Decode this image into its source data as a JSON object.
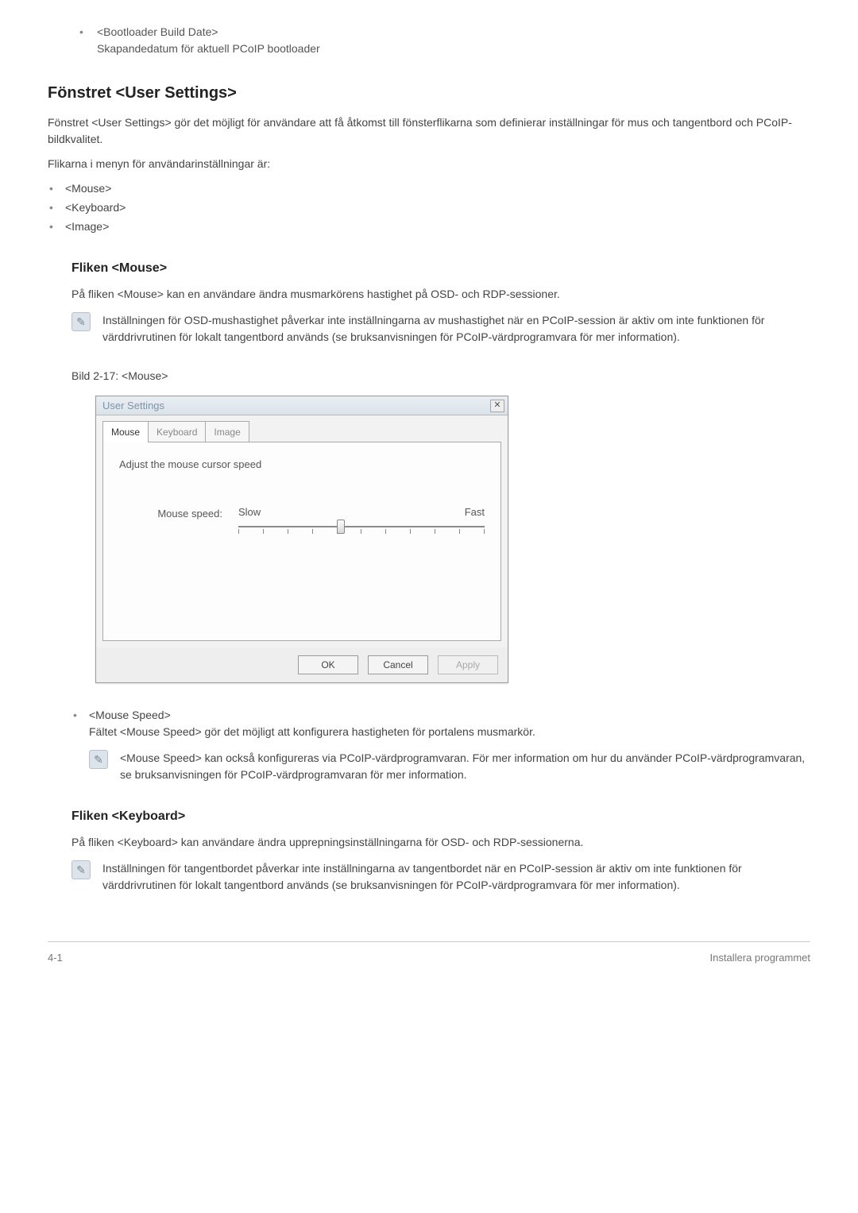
{
  "bullets_top": [
    {
      "title": "<Bootloader Build Date>",
      "desc": "Skapandedatum för aktuell PCoIP bootloader"
    }
  ],
  "section": {
    "title": "Fönstret <User Settings>",
    "intro": "Fönstret <User Settings> gör det möjligt för användare att få åtkomst till fönsterflikarna som definierar inställningar för mus och tangentbord och PCoIP-bildkvalitet.",
    "tabs_intro": "Flikarna i menyn för användarinställningar är:",
    "tabs": [
      "<Mouse>",
      "<Keyboard>",
      "<Image>"
    ]
  },
  "mouse": {
    "heading": "Fliken <Mouse>",
    "intro": "På fliken <Mouse> kan en användare ändra musmarkörens hastighet på OSD- och RDP-sessioner.",
    "note": "Inställningen för OSD-mushastighet påverkar inte inställningarna av mushastighet när en PCoIP-session är aktiv om inte funktionen för värddrivrutinen för lokalt tangentbord används (se bruksanvisningen för PCoIP-värdprogramvara för mer information).",
    "fig_label": "Bild 2-17: <Mouse>",
    "dialog": {
      "title": "User Settings",
      "tabs": {
        "mouse": "Mouse",
        "keyboard": "Keyboard",
        "image": "Image"
      },
      "pane_heading": "Adjust the mouse cursor speed",
      "slider_label": "Mouse speed:",
      "slow": "Slow",
      "fast": "Fast",
      "buttons": {
        "ok": "OK",
        "cancel": "Cancel",
        "apply": "Apply"
      }
    },
    "speed_bullet": {
      "title": "<Mouse Speed>",
      "desc": "Fältet <Mouse Speed> gör det möjligt att konfigurera hastigheten för portalens musmarkör.",
      "note": "<Mouse Speed> kan också konfigureras via PCoIP-värdprogramvaran. För mer information om hur du använder PCoIP-värdprogramvaran, se bruksanvisningen för PCoIP-värdprogramvaran för mer information."
    }
  },
  "keyboard": {
    "heading": "Fliken <Keyboard>",
    "intro": "På fliken <Keyboard> kan användare ändra upprepningsinställningarna för OSD- och RDP-sessionerna.",
    "note": "Inställningen för tangentbordet påverkar inte inställningarna av tangentbordet när en PCoIP-session är aktiv om inte funktionen för värddrivrutinen för lokalt tangentbord används (se bruksanvisningen för PCoIP-värdprogramvara för mer information)."
  },
  "footer": {
    "left": "4-1",
    "right": "Installera programmet"
  }
}
